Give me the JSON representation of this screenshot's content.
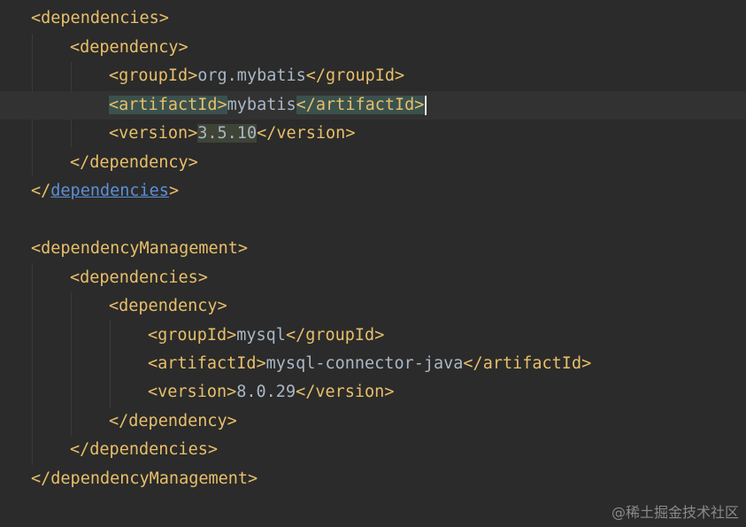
{
  "editor": {
    "lines": [
      "<dependencies>",
      "<dependency>",
      "<groupId>",
      "org.mybatis",
      "</groupId>",
      "<artifactId>",
      "mybatis",
      "</artifactId>",
      "<version>",
      "3.5.10",
      "</version>",
      "</dependency>",
      "</",
      "dependencies",
      ">",
      "<dependencyManagement>",
      "<dependencies>",
      "<dependency>",
      "<groupId>",
      "mysql",
      "</groupId>",
      "<artifactId>",
      "mysql-connector-java",
      "</artifactId>",
      "<version>",
      "8.0.29",
      "</version>",
      "</dependency>",
      "</dependencies>",
      "</dependencyManagement>"
    ]
  },
  "watermark": "@稀土掘金技术社区",
  "colors": {
    "background": "#2b2b2b",
    "tag": "#e8bf6a",
    "text": "#a9b7c6",
    "link": "#5c8fd6"
  }
}
